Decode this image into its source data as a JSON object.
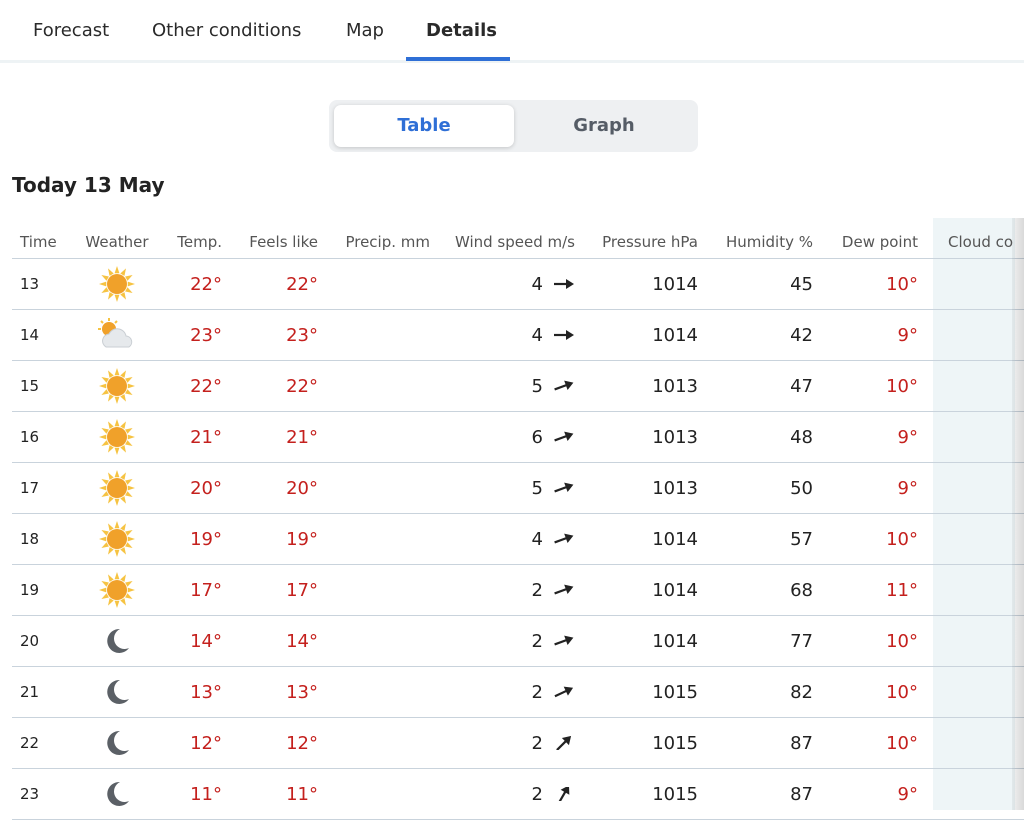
{
  "tabs": [
    {
      "label": "Forecast"
    },
    {
      "label": "Other conditions"
    },
    {
      "label": "Map"
    },
    {
      "label": "Details",
      "active": true
    }
  ],
  "view_toggle": {
    "table": "Table",
    "graph": "Graph",
    "selected": "Table"
  },
  "day_title": "Today 13 May",
  "colors": {
    "accent": "#2f6fd6",
    "temperature": "#c4201d",
    "cloud_column_bg": "#eef5f7"
  },
  "headers": {
    "time": "Time",
    "weather": "Weather",
    "temp": "Temp.",
    "feels": "Feels like",
    "precip": "Precip. mm",
    "wind": "Wind speed m/s",
    "pressure": "Pressure hPa",
    "humidity": "Humidity %",
    "dew": "Dew point",
    "cloud": "Cloud co"
  },
  "rows": [
    {
      "time": "13",
      "icon": "sun",
      "temp": "22°",
      "feels": "22°",
      "wind": "4",
      "wind_dir_deg": 0,
      "pressure": "1014",
      "humidity": "45",
      "dew": "10°"
    },
    {
      "time": "14",
      "icon": "partly-cloudy",
      "temp": "23°",
      "feels": "23°",
      "wind": "4",
      "wind_dir_deg": 0,
      "pressure": "1014",
      "humidity": "42",
      "dew": "9°"
    },
    {
      "time": "15",
      "icon": "sun",
      "temp": "22°",
      "feels": "22°",
      "wind": "5",
      "wind_dir_deg": -20,
      "pressure": "1013",
      "humidity": "47",
      "dew": "10°"
    },
    {
      "time": "16",
      "icon": "sun",
      "temp": "21°",
      "feels": "21°",
      "wind": "6",
      "wind_dir_deg": -20,
      "pressure": "1013",
      "humidity": "48",
      "dew": "9°"
    },
    {
      "time": "17",
      "icon": "sun",
      "temp": "20°",
      "feels": "20°",
      "wind": "5",
      "wind_dir_deg": -20,
      "pressure": "1013",
      "humidity": "50",
      "dew": "9°"
    },
    {
      "time": "18",
      "icon": "sun",
      "temp": "19°",
      "feels": "19°",
      "wind": "4",
      "wind_dir_deg": -20,
      "pressure": "1014",
      "humidity": "57",
      "dew": "10°"
    },
    {
      "time": "19",
      "icon": "sun",
      "temp": "17°",
      "feels": "17°",
      "wind": "2",
      "wind_dir_deg": -20,
      "pressure": "1014",
      "humidity": "68",
      "dew": "11°"
    },
    {
      "time": "20",
      "icon": "moon",
      "temp": "14°",
      "feels": "14°",
      "wind": "2",
      "wind_dir_deg": -20,
      "pressure": "1014",
      "humidity": "77",
      "dew": "10°"
    },
    {
      "time": "21",
      "icon": "moon",
      "temp": "13°",
      "feels": "13°",
      "wind": "2",
      "wind_dir_deg": -25,
      "pressure": "1015",
      "humidity": "82",
      "dew": "10°"
    },
    {
      "time": "22",
      "icon": "moon",
      "temp": "12°",
      "feels": "12°",
      "wind": "2",
      "wind_dir_deg": -45,
      "pressure": "1015",
      "humidity": "87",
      "dew": "10°"
    },
    {
      "time": "23",
      "icon": "moon",
      "temp": "11°",
      "feels": "11°",
      "wind": "2",
      "wind_dir_deg": -60,
      "pressure": "1015",
      "humidity": "87",
      "dew": "9°"
    }
  ]
}
